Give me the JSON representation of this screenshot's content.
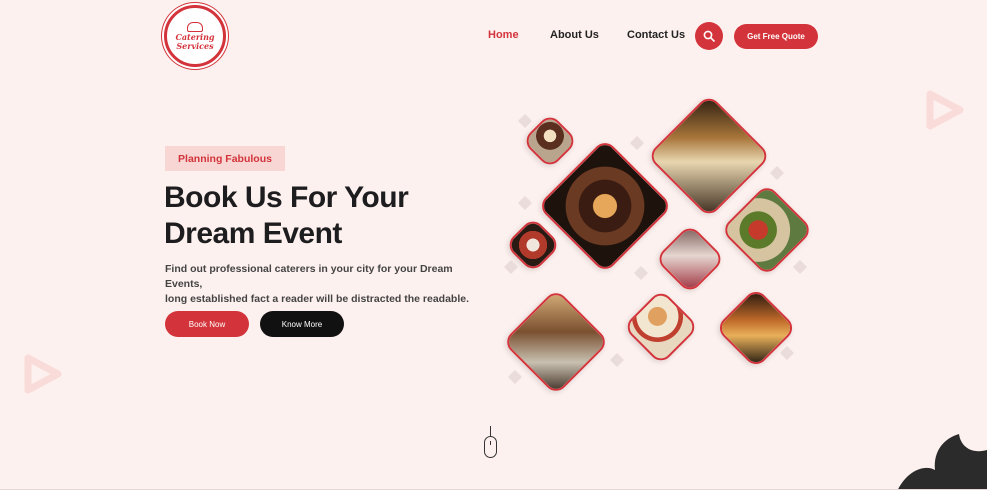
{
  "logo": {
    "text_line1": "Catering",
    "text_line2": "Services"
  },
  "nav": {
    "home": "Home",
    "about": "About Us",
    "contact": "Contact Us",
    "quote_button": "Get Free Quote"
  },
  "hero": {
    "badge": "Planning Fabulous",
    "headline_line1": "Book Us For Your",
    "headline_line2": "Dream Event",
    "description_line1": "Find out professional caterers in your city for your Dream Events,",
    "description_line2": "long established fact a reader will be distracted the readable.",
    "book_button": "Book Now",
    "more_button": "Know More"
  },
  "colors": {
    "accent": "#d3333a",
    "background": "#fdf1ef",
    "dark": "#111111"
  },
  "icons": [
    "search-icon",
    "play-icon",
    "mouse-scroll-icon",
    "leaf-icon",
    "chef-hat-icon"
  ]
}
